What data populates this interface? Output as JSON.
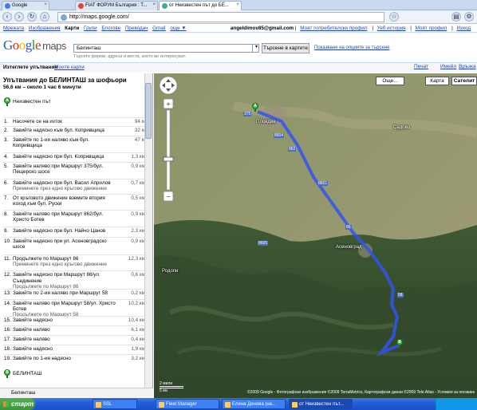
{
  "browser": {
    "tabs": [
      {
        "label": "Google",
        "icon": "google-icon"
      },
      {
        "label": "FIAT ФОРУМ България : Т...",
        "icon": "forum-icon"
      },
      {
        "label": "от Неизвестен път до БЕ...",
        "icon": "maps-icon"
      }
    ],
    "url": "http://maps.google.com/"
  },
  "gbar": {
    "links": [
      "Мрежата",
      "Изображения",
      "Карти",
      "Групи",
      "Блогове",
      "Преводач",
      "Gmail",
      "още ▼"
    ],
    "current": "Карти",
    "user_email": "angeldimov85@gmail.com",
    "user_links": [
      "Моят потребителски профил",
      "Уеб история",
      "Моят профил",
      "Изход"
    ]
  },
  "search": {
    "logo": "Google",
    "logo_suffix": "maps",
    "query": "Белинташ",
    "button": "Търсене в картите",
    "options_link": "Показване на опциите за търсене",
    "hint": "Търсете фирми, адреси и места, които ви интересуват."
  },
  "subbar": {
    "results": "Изтеглете упътвания",
    "my_maps": "Моите карти",
    "print": "Печат",
    "email": "Имейл",
    "link": "Връзка"
  },
  "directions": {
    "title": "Упътвания до БЕЛИНТАШ за шофьори",
    "summary": "56,6 км – около 1 час 6 минути",
    "start": "Неизвестен път",
    "end": "БЕЛИНТАШ",
    "steps": [
      {
        "n": "1.",
        "text": "Насочете се на изток",
        "dist": "94 м"
      },
      {
        "n": "2.",
        "text": "Завийте надясно към бул. Копривщица",
        "dist": "32 м"
      },
      {
        "n": "3.",
        "text": "Завийте по 1-ия наляво към бул. Копривщица",
        "dist": "47 м"
      },
      {
        "n": "4.",
        "text": "Завийте надясно при бул. Копривщица",
        "dist": "1,3 км"
      },
      {
        "n": "5.",
        "text": "Завийте наляво при Маршрут 375/бул. Пещерско шосе",
        "dist": "0,9 км"
      },
      {
        "n": "6.",
        "text": "Завийте надясно при бул. Васил Априлов",
        "sub": "Преминете през едно кръгово движение",
        "dist": "0,7 км"
      },
      {
        "n": "7.",
        "text": "От кръговото движение вземете втория изход към бул. Руски",
        "dist": "0,5 км"
      },
      {
        "n": "8.",
        "text": "Завийте наляво при Маршрут 862/бул. Христо Ботев",
        "dist": "0,9 км"
      },
      {
        "n": "9.",
        "text": "Завийте надясно при бул. Найчо Цанов",
        "dist": "2,3 км"
      },
      {
        "n": "10.",
        "text": "Завийте надясно при ул. Асеновградско шосе",
        "dist": "0,9 км"
      },
      {
        "n": "11.",
        "text": "Продължете по Маршрут 86",
        "sub": "Преминете през едно кръгово движение",
        "dist": "12,3 км"
      },
      {
        "n": "12.",
        "text": "Завийте надясно при Маршрут 86/ул. Съединение",
        "sub": "Продължете по Маршрут 86",
        "dist": "0,6 км"
      },
      {
        "n": "13.",
        "text": "Завийте по 2-ия наляво при Маршрут 58",
        "dist": "0,2 км"
      },
      {
        "n": "14.",
        "text": "Завийте наляво при Маршрут 58/ул. Христо Ботев",
        "sub": "Продължете по Маршрут 58",
        "dist": "10,2 км"
      },
      {
        "n": "15.",
        "text": "Завийте надясно",
        "dist": "10,4 км"
      },
      {
        "n": "16.",
        "text": "Завийте наляво",
        "dist": "6,1 км"
      },
      {
        "n": "17.",
        "text": "Завийте наляво",
        "dist": "0,4 км"
      },
      {
        "n": "18.",
        "text": "Завийте надясно",
        "dist": "1,9 км"
      },
      {
        "n": "19.",
        "text": "Завийте по 1-ия надясно",
        "dist": "3,2 км"
      }
    ],
    "status": "Белинташ"
  },
  "map": {
    "buttons": [
      "Още...",
      "Карта",
      "Сателит"
    ],
    "towns": [
      "Пловдив",
      "Асеновград",
      "Родопи",
      "Садово"
    ],
    "roads": [
      "8604",
      "8601",
      "86",
      "58",
      "375",
      "862",
      "8605"
    ],
    "copyright": "©2009 Google - Фотографски изображения ©2009 TerraMetrics, Картографски данни ©2009 Tele Atlas - Условия за ползване",
    "scale_top": "2 мили",
    "scale_bottom": "5 км",
    "start_marker": "A",
    "end_marker": "B"
  },
  "taskbar": {
    "start": "старт",
    "buttons": [
      "SSL",
      "Fleet Manager",
      "Елена Динова (на...",
      "от Неизвестен път..."
    ]
  }
}
